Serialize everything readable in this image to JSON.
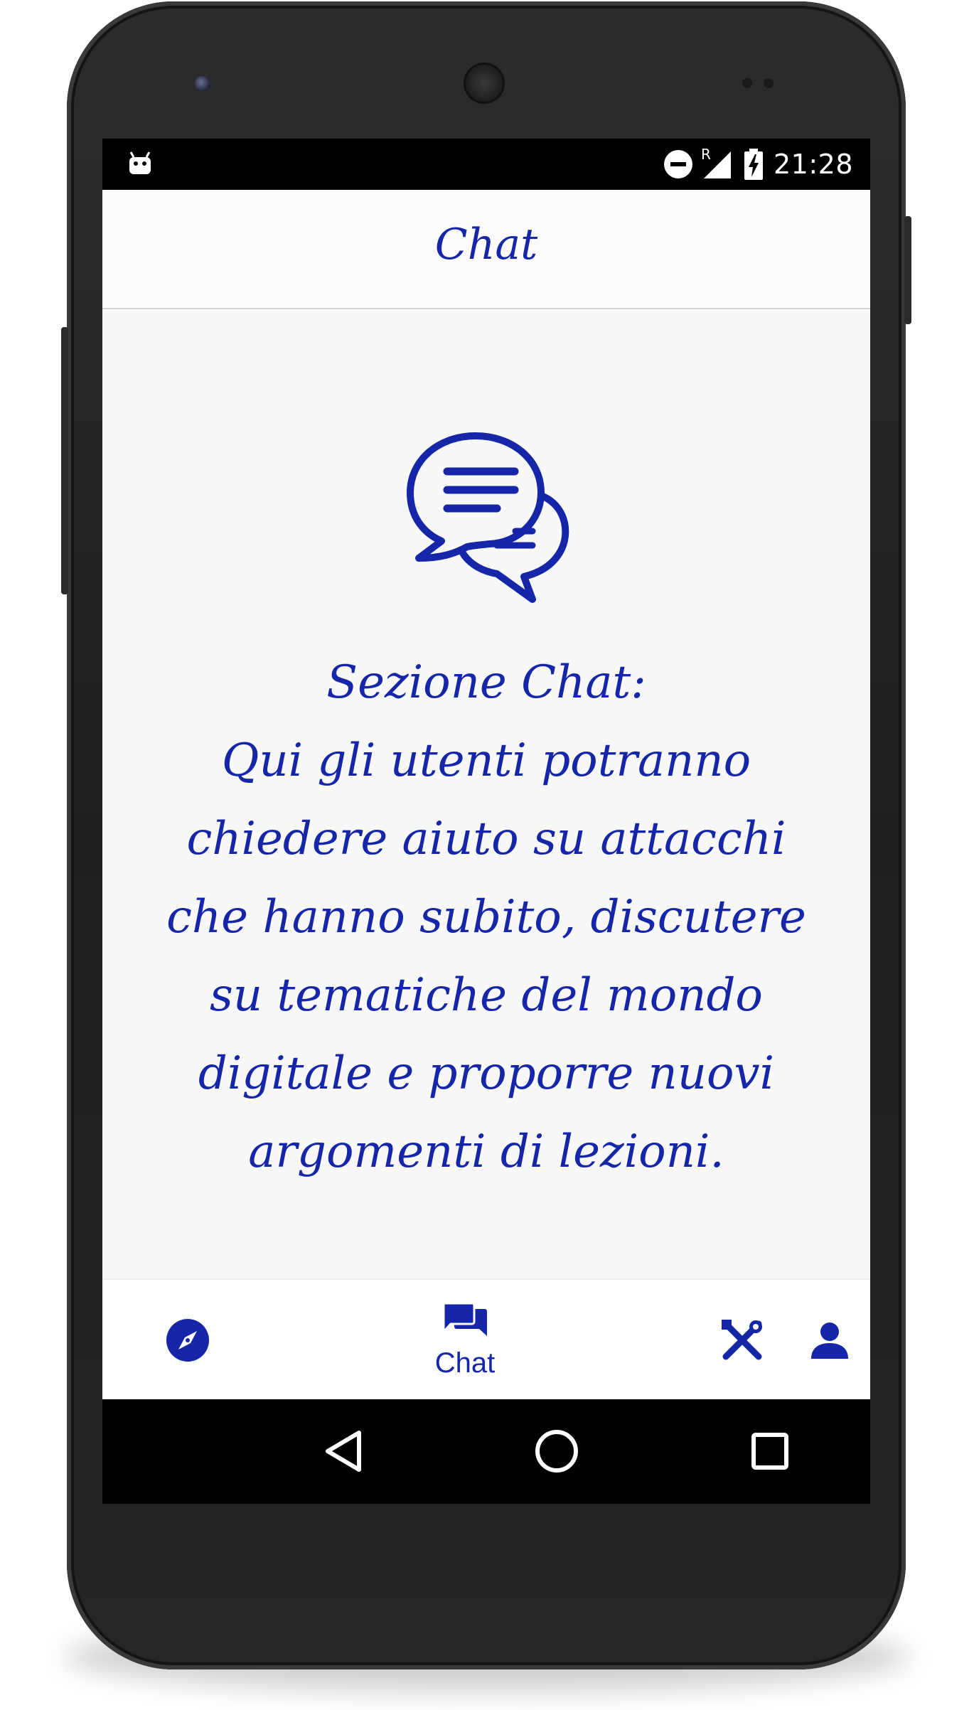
{
  "status_bar": {
    "time": "21:28",
    "roaming_label": "R",
    "icons": [
      "android-debug-icon",
      "do-not-disturb-icon",
      "signal-icon",
      "battery-charging-icon"
    ]
  },
  "app_bar": {
    "title": "Chat"
  },
  "content": {
    "illustration": "chat-bubbles-icon",
    "text": "Sezione Chat:\nQui gli utenti potranno chiedere aiuto su attacchi che hanno subito, discutere su tematiche del mondo digitale e proporre nuovi argomenti di lezioni."
  },
  "bottom_nav": {
    "items": [
      {
        "icon": "compass-icon",
        "label": ""
      },
      {
        "icon": "forum-icon",
        "label": "Chat",
        "selected": true
      },
      {
        "icon": "tools-icon",
        "label": ""
      },
      {
        "icon": "person-icon",
        "label": ""
      }
    ]
  },
  "system_nav": {
    "buttons": [
      "back-icon",
      "home-icon",
      "recents-icon"
    ]
  },
  "colors": {
    "accent": "#1526a8",
    "app_bar_bg": "#fdfafc",
    "content_bg": "#f8f8f9",
    "status_bar_bg": "#000000"
  }
}
